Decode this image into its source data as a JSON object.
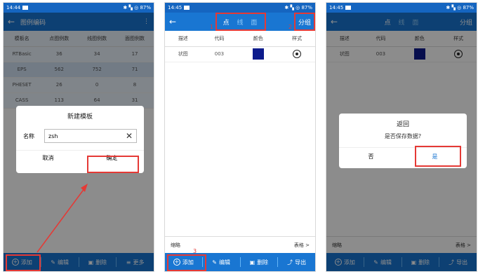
{
  "panel1": {
    "status": {
      "time": "14:44",
      "right": "✱ ▚ ◎ 87%"
    },
    "title": "图例编码",
    "columns": [
      "模板名",
      "点图例数",
      "线图例数",
      "面图例数"
    ],
    "rows": [
      [
        "RTBasic",
        "36",
        "34",
        "17"
      ],
      [
        "EPS",
        "562",
        "752",
        "71"
      ],
      [
        "PHESET",
        "26",
        "0",
        "8"
      ],
      [
        "CASS",
        "113",
        "64",
        "31"
      ]
    ],
    "dialog": {
      "title": "新建模板",
      "name_label": "名称",
      "name_value": "zsh",
      "cancel": "取消",
      "ok": "确定"
    },
    "bottom": {
      "add": "添加",
      "edit": "编辑",
      "delete": "删除",
      "more": "更多"
    }
  },
  "panel2": {
    "status": {
      "time": "14:45",
      "right": "✱ ▚ ◎ 87%"
    },
    "tabs": [
      "点",
      "线",
      "面"
    ],
    "group": "分组",
    "columns": [
      "描述",
      "代码",
      "颜色",
      "样式"
    ],
    "row": {
      "desc": "状图",
      "code": "003"
    },
    "footer_left": "缩略",
    "footer_right": "表格 >",
    "bottom": {
      "add": "添加",
      "edit": "编辑",
      "delete": "删除",
      "export": "导出"
    },
    "marks": {
      "m1": "1",
      "m2": "2",
      "m3": "3"
    }
  },
  "panel3": {
    "status": {
      "time": "14:45",
      "right": "✱ ▚ ◎ 87%"
    },
    "tabs": [
      "点",
      "线",
      "面"
    ],
    "group": "分组",
    "columns": [
      "描述",
      "代码",
      "颜色",
      "样式"
    ],
    "row": {
      "desc": "状图",
      "code": "003"
    },
    "footer_left": "缩略",
    "footer_right": "表格 >",
    "dialog": {
      "title": "返回",
      "message": "是否保存数据?",
      "no": "否",
      "yes": "是"
    },
    "bottom": {
      "add": "添加",
      "edit": "编辑",
      "delete": "删除",
      "export": "导出"
    }
  },
  "colors": {
    "primary": "#1976d2",
    "highlight": "#e53935",
    "swatch": "#0d1b8c"
  }
}
